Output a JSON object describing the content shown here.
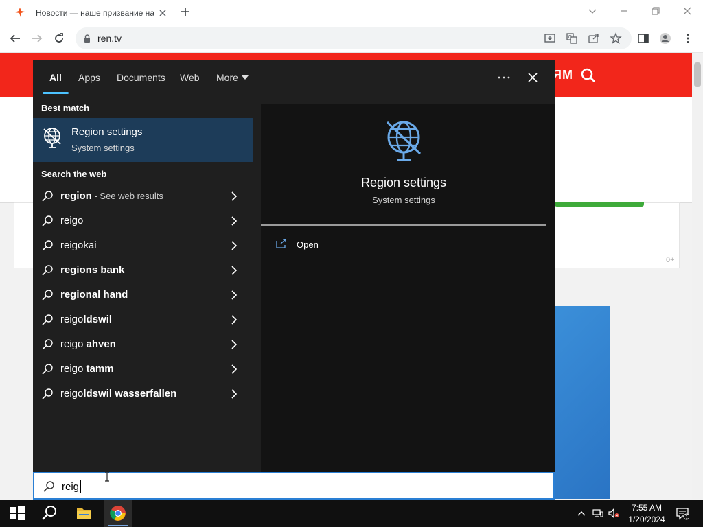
{
  "browser": {
    "tab_title": "Новости — наше призвание на",
    "url": "ren.tv"
  },
  "page": {
    "header_text": "ЯМ",
    "counter": "0+"
  },
  "search_panel": {
    "tabs": [
      "All",
      "Apps",
      "Documents",
      "Web",
      "More"
    ],
    "best_match_label": "Best match",
    "best_match": {
      "title": "Region settings",
      "subtitle": "System settings"
    },
    "web_label": "Search the web",
    "web_results": [
      {
        "prefix": "",
        "bold": "region",
        "suffix": " - See web results"
      },
      {
        "prefix": "reigo",
        "bold": "",
        "suffix": ""
      },
      {
        "prefix": "reigokai",
        "bold": "",
        "suffix": ""
      },
      {
        "prefix": "",
        "bold": "regions bank",
        "suffix": ""
      },
      {
        "prefix": "",
        "bold": "regional hand",
        "suffix": ""
      },
      {
        "prefix": "reigo",
        "bold": "ldswil",
        "suffix": ""
      },
      {
        "prefix": "reigo ",
        "bold": "ahven",
        "suffix": ""
      },
      {
        "prefix": "reigo ",
        "bold": "tamm",
        "suffix": ""
      },
      {
        "prefix": "reigo",
        "bold": "ldswil wasserfallen",
        "suffix": ""
      }
    ],
    "detail": {
      "title": "Region settings",
      "subtitle": "System settings",
      "action": "Open"
    },
    "query": "reig"
  },
  "taskbar": {
    "time": "7:55 AM",
    "date": "1/20/2024"
  },
  "colors": {
    "accent": "#4cc2ff",
    "best_match_bg": "#1d3c59",
    "panel_bg": "#1f1f1f",
    "brand_red": "#f2261b"
  }
}
